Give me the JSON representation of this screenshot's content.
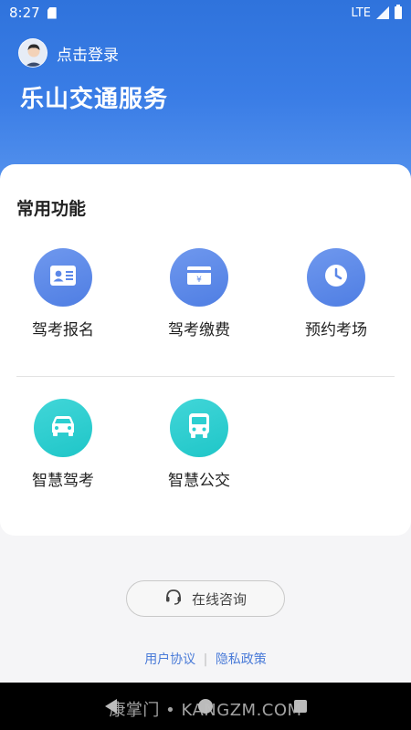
{
  "status_bar": {
    "time": "8:27",
    "network": "LTE"
  },
  "header": {
    "login_text": "点击登录",
    "title": "乐山交通服务",
    "gradient_start": "#2f73dc",
    "gradient_end": "#5f9af0"
  },
  "functions": {
    "section_title": "常用功能",
    "items": [
      {
        "label": "驾考报名",
        "icon": "id-card-icon",
        "color": "#5b87e8"
      },
      {
        "label": "驾考缴费",
        "icon": "payment-card-icon",
        "color": "#5b87e8"
      },
      {
        "label": "预约考场",
        "icon": "clock-icon",
        "color": "#5b87e8"
      },
      {
        "label": "智慧驾考",
        "icon": "car-icon",
        "color": "#2ccfd1"
      },
      {
        "label": "智慧公交",
        "icon": "bus-icon",
        "color": "#2ccfd1"
      }
    ]
  },
  "consult": {
    "label": "在线咨询",
    "icon": "headset-icon"
  },
  "links": {
    "user_agreement": "用户协议",
    "separator": "|",
    "privacy_policy": "隐私政策"
  },
  "watermark": "康掌门 • KANGZM.COM"
}
